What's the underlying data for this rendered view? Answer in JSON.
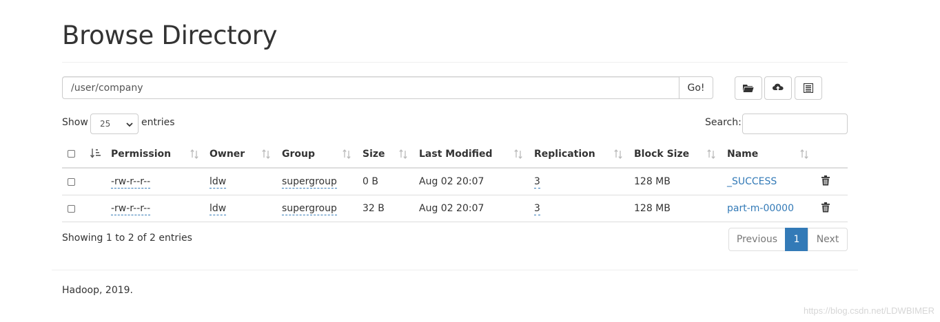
{
  "page": {
    "title": "Browse Directory"
  },
  "path_bar": {
    "value": "/user/company",
    "go_label": "Go!"
  },
  "toolbar": {
    "icons": [
      "folder-open-icon",
      "cloud-upload-icon",
      "list-alt-icon"
    ]
  },
  "controls": {
    "show_label": "Show",
    "entries_value": "25",
    "entries_label": "entries",
    "search_label": "Search:",
    "search_value": ""
  },
  "table": {
    "columns": [
      "Permission",
      "Owner",
      "Group",
      "Size",
      "Last Modified",
      "Replication",
      "Block Size",
      "Name"
    ],
    "rows": [
      {
        "permission": "-rw-r--r--",
        "owner": "ldw",
        "group": "supergroup",
        "size": "0 B",
        "modified": "Aug 02 20:07",
        "replication": "3",
        "block_size": "128 MB",
        "name": "_SUCCESS"
      },
      {
        "permission": "-rw-r--r--",
        "owner": "ldw",
        "group": "supergroup",
        "size": "32 B",
        "modified": "Aug 02 20:07",
        "replication": "3",
        "block_size": "128 MB",
        "name": "part-m-00000"
      }
    ]
  },
  "info": {
    "text": "Showing 1 to 2 of 2 entries"
  },
  "pagination": {
    "previous": "Previous",
    "current": "1",
    "next": "Next"
  },
  "footer": {
    "text": "Hadoop, 2019."
  },
  "watermark": "https://blog.csdn.net/LDWBIMER",
  "colors": {
    "link": "#337ab7",
    "active_page": "#337ab7",
    "border": "#dddddd"
  }
}
